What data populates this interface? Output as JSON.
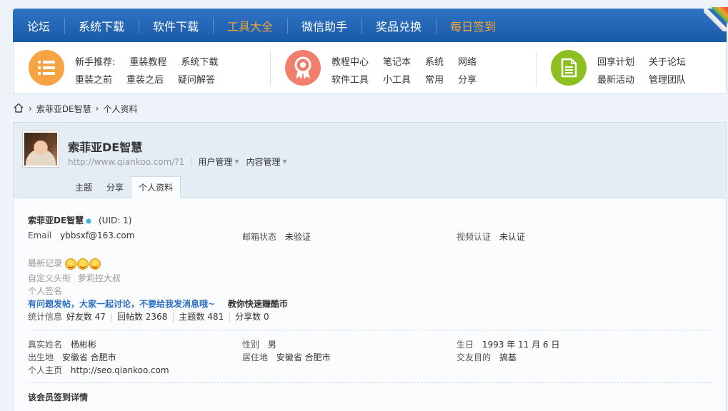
{
  "nav": {
    "items": [
      {
        "label": "论坛",
        "hot": false
      },
      {
        "label": "系统下载",
        "hot": false
      },
      {
        "label": "软件下载",
        "hot": false
      },
      {
        "label": "工具大全",
        "hot": true
      },
      {
        "label": "微信助手",
        "hot": false
      },
      {
        "label": "奖品兑换",
        "hot": false
      },
      {
        "label": "每日签到",
        "hot": true
      }
    ]
  },
  "quicknav": {
    "group1": {
      "icon": "list-icon",
      "color": "#f6a443",
      "row1": [
        "新手推荐:",
        "重装教程",
        "系统下载"
      ],
      "row2": [
        "重装之前",
        "重装之后",
        "疑问解答"
      ]
    },
    "group2": {
      "icon": "award-icon",
      "color": "#f27e6e",
      "row1": [
        "教程中心",
        "笔记本",
        "系统",
        "网络"
      ],
      "row2": [
        "软件工具",
        "小工具",
        "常用",
        "分享"
      ]
    },
    "group3": {
      "icon": "document-icon",
      "color": "#8cbf1f",
      "row1": [
        "回享计划",
        "关于论坛"
      ],
      "row2": [
        "最新活动",
        "管理团队"
      ]
    }
  },
  "breadcrumb": {
    "items": [
      "索菲亚DE智慧",
      "个人资料"
    ]
  },
  "profile": {
    "name": "索菲亚DE智慧",
    "url": "http://www.qiankoo.com/?1",
    "menus": [
      "用户管理",
      "内容管理"
    ],
    "tabs": [
      "主题",
      "分享",
      "个人资料"
    ],
    "active_tab": "个人资料",
    "uid_text": "(UID: 1)",
    "email_label": "Email",
    "email": "ybbsxf@163.com",
    "mail_status_label": "邮箱状态",
    "mail_status": "未验证",
    "video_label": "视频认证",
    "video_status": "未认证",
    "recent_label": "最新记录",
    "title_label": "自定义头衔",
    "title_value": "萝莉控大叔",
    "sign_label": "个人签名",
    "sign_text": "有问题发帖，大家一起讨论，不要给我发消息哦~",
    "sign_link": "教你快速赚酷币",
    "stats_label": "统计信息",
    "friends": "好友数 47",
    "replies": "回帖数 2368",
    "threads": "主题数 481",
    "shares": "分享数 0",
    "realname_label": "真实姓名",
    "realname": "杨彬彬",
    "gender_label": "性别",
    "gender": "男",
    "birthday_label": "生日",
    "birthday": "1993 年 11 月 6 日",
    "birthplace_label": "出生地",
    "birthplace": "安徽省 合肥市",
    "residence_label": "居住地",
    "residence": "安徽省 合肥市",
    "purpose_label": "交友目的",
    "purpose": "搞基",
    "homepage_label": "个人主页",
    "homepage": "http://seo.qiankoo.com",
    "checkin_title": "该会员签到详情"
  }
}
